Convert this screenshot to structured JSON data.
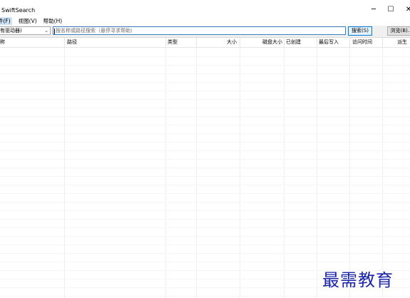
{
  "window": {
    "title": "SwiftSearch",
    "controls": {
      "minimize": "─",
      "maximize": "☐",
      "close": "✕"
    }
  },
  "menu": [
    "件(F)",
    "视图(V)",
    "帮助(H)"
  ],
  "search_bar": {
    "drive_value": "有驱动器)",
    "search_placeholder": "按名称或路径搜索（悬停寻求帮助）",
    "search_button": "搜索(S)",
    "browse_button": "浏览(B)..."
  },
  "columns": [
    "称",
    "路径",
    "类型",
    "大小",
    "磁盘大小",
    "已创建",
    "最后写入",
    "访问时间",
    "派生"
  ],
  "watermark": "最需教育",
  "colors": {
    "accent": "#0078d7",
    "selected_menu": "#cfe3f8",
    "watermark": "#1a25a8"
  }
}
